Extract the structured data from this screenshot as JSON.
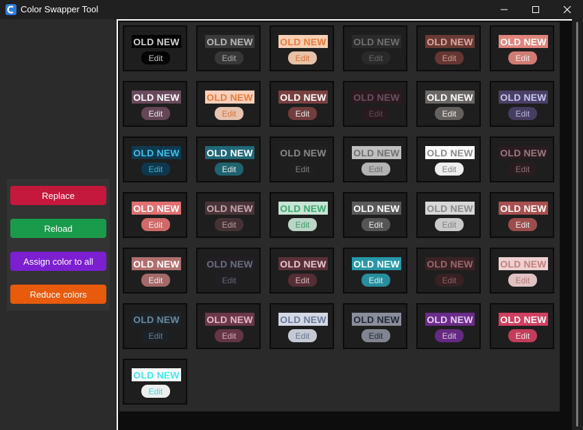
{
  "window": {
    "title": "Color Swapper Tool",
    "minimize_glyph": "—",
    "close_glyph": "✕"
  },
  "actions": [
    {
      "label": "Replace",
      "color": "#c4183c"
    },
    {
      "label": "Reload",
      "color": "#1a9b4b"
    },
    {
      "label": "Assign color to all",
      "color": "#7c1fd1"
    },
    {
      "label": "Reduce colors",
      "color": "#e85a0c"
    }
  ],
  "card_text": {
    "old": "OLD",
    "new": "NEW",
    "edit": "Edit"
  },
  "colors": [
    "#000000",
    "#3a3a3a",
    "#f8d0b4",
    "#2a2a2a",
    "#6a3a34",
    "#e0857c",
    "#6a4a5c",
    "#f8d0bc",
    "#7a4040",
    "#2a1a20",
    "#6a6664",
    "#4a4066",
    "#0e3a50",
    "#206878",
    "#202020",
    "#c0c0c0",
    "#ffffff",
    "#2a1c20",
    "#e07070",
    "#4a3438",
    "#c8e4d4",
    "#5a5a5a",
    "#d8d8d8",
    "#a85050",
    "#b07070",
    "#221e24",
    "#5a3038",
    "#2898a8",
    "#3a2224",
    "#f0d0d0",
    "#1c2228",
    "#6a3848",
    "#d4d8e4",
    "#8a8e9a",
    "#6a2c8a",
    "#d04060",
    "#ffffff"
  ],
  "text_colors": [
    "#d4d4d4",
    "#b8b8b8",
    "#e87a3a",
    "#707070",
    "#e0a8a0",
    "#ffffff",
    "#ffffff",
    "#e87a3a",
    "#ffffff",
    "#6a5060",
    "#ffffff",
    "#c8c8f0",
    "#3ec0e8",
    "#ffffff",
    "#8a8a8a",
    "#707070",
    "#8a8a8a",
    "#9a7a80",
    "#ffffff",
    "#c8a8b0",
    "#3aa870",
    "#ffffff",
    "#8a8a8a",
    "#ffffff",
    "#ffffff",
    "#6a7080",
    "#e8c8d0",
    "#ffffff",
    "#9a6870",
    "#c08080",
    "#6a8aa0",
    "#e8b8c8",
    "#6a7a9a",
    "#222838",
    "#e8d0f0",
    "#ffffff",
    "#3ee8f0"
  ]
}
